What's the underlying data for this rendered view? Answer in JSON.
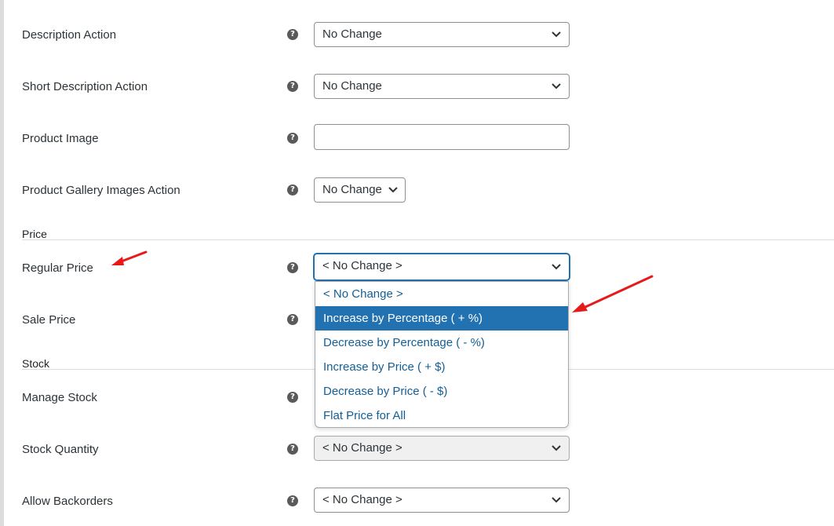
{
  "rows": [
    {
      "label": "Description Action",
      "value": "No Change"
    },
    {
      "label": "Short Description Action",
      "value": "No Change"
    },
    {
      "label": "Product Image",
      "value": ""
    },
    {
      "label": "Product Gallery Images Action",
      "value": "No Change"
    },
    {
      "label": "Regular Price",
      "value": "< No Change >"
    },
    {
      "label": "Sale Price",
      "value": ""
    },
    {
      "label": "Manage Stock",
      "value": ""
    },
    {
      "label": "Stock Quantity",
      "value": "< No Change >"
    },
    {
      "label": "Allow Backorders",
      "value": "< No Change >"
    }
  ],
  "sections": {
    "price": "Price",
    "stock": "Stock"
  },
  "help_symbol": "?",
  "regular_price_dropdown": {
    "options": [
      "< No Change >",
      "Increase by Percentage ( + %)",
      "Decrease by Percentage ( - %)",
      "Increase by Price ( + $)",
      "Decrease by Price ( - $)",
      "Flat Price for All"
    ],
    "highlighted": "Increase by Percentage ( + %)"
  },
  "colors": {
    "accent": "#2271b1",
    "annotation_arrow": "#e8191a"
  }
}
